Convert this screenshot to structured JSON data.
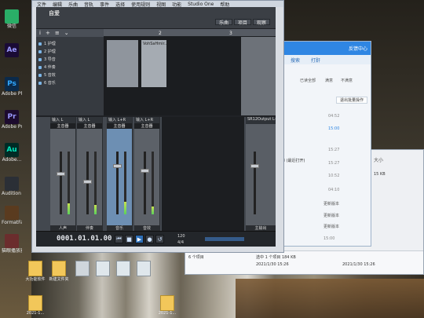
{
  "desktop": {
    "left_icons": [
      {
        "label": "Adobe Photosh...",
        "glyph": "Ps",
        "color": "#0b2a4a",
        "fg": "#31a8ff"
      },
      {
        "label": "Adobe Premiere...",
        "glyph": "Pr",
        "color": "#1d0b2e",
        "fg": "#9999ff"
      },
      {
        "label": "Adobe...",
        "glyph": "Au",
        "color": "#002b25",
        "fg": "#00e4bb"
      },
      {
        "label": "Audition Pro",
        "glyph": "",
        "color": "#2b2f36",
        "fg": "#ddd"
      },
      {
        "label": "FormatFac...",
        "glyph": "",
        "color": "#5a3b1f",
        "fg": "#fff"
      },
      {
        "label": "猫眼播放器",
        "glyph": "",
        "color": "#6b2d2d",
        "fg": "#fff"
      }
    ],
    "top_icon_labels": [
      "微信",
      "Ae"
    ],
    "bottom_icons": [
      "大功能软件",
      "新建文件夹",
      "",
      "",
      "",
      "",
      "2021-1...",
      "2021-1..."
    ]
  },
  "studio": {
    "menu": [
      "文件",
      "编辑",
      "乐曲",
      "音轨",
      "事件",
      "选择",
      "使用规则",
      "视图",
      "功能",
      "Studio One",
      "帮助"
    ],
    "song_title": "自爱",
    "toolbar_buttons": [
      "乐曲",
      "项目",
      "观察"
    ],
    "ruler_marks": [
      "2",
      "3"
    ],
    "left_tools": [
      "i",
      "+",
      "≡",
      "⌄"
    ],
    "tracks": [
      "1 护理",
      "2 护理",
      "3 导音",
      "4 伴奏",
      "5 音效",
      "6 音乐"
    ],
    "browser_label": "VohSaHmir...",
    "channels": [
      {
        "head": "输入 L",
        "name": "主音器",
        "foot": "人声"
      },
      {
        "head": "输入 L",
        "name": "主音器",
        "foot": "伴奏"
      },
      {
        "head": "输入 L+R",
        "name": "主音器",
        "foot": "音乐"
      },
      {
        "head": "输入 L+R",
        "name": "主音器",
        "foot": "音效"
      }
    ],
    "main_bus": {
      "head": "SR12Output L+R",
      "foot": "主输出"
    },
    "transport": {
      "time": "0001.01.01.00",
      "tempo": "120",
      "sig": "4/4"
    }
  },
  "chat": {
    "tabs": [
      "搜索",
      "打鼾"
    ],
    "top_actions": [
      "反馈中心"
    ],
    "header_actions": [
      "已读全部",
      "满意",
      "不满意"
    ],
    "batch_button": "退出批量操作",
    "lines": [
      "04:52",
      "15:00",
      "15:27",
      "你 (最近打开)",
      "15:27",
      "10:52",
      "04:10",
      "15:07",
      "更新版本",
      "15:07",
      "更新版本",
      "15:07",
      "更新版本",
      "15:00"
    ]
  },
  "explorer": {
    "header": "大小",
    "size_value": "15 KB",
    "footer": [
      "6 个项目",
      "选中 1 个项目 184 KB",
      "2021/1/30 15:26"
    ],
    "row_time": "2021/1/30 15:26"
  }
}
